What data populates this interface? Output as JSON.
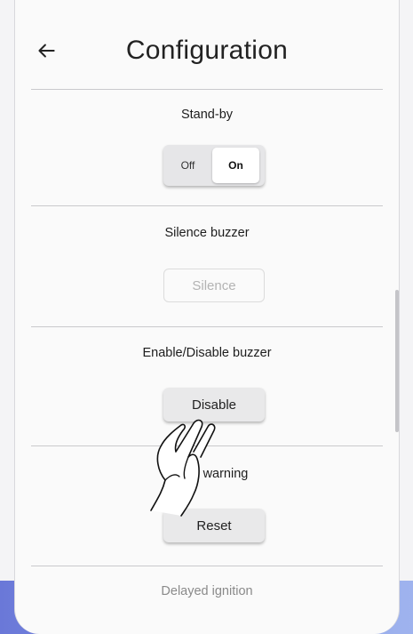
{
  "header": {
    "title": "Configuration",
    "back_icon": "arrow-left-icon"
  },
  "sections": {
    "standby": {
      "title": "Stand-by",
      "off_label": "Off",
      "on_label": "On",
      "selected": "On"
    },
    "silence_buzzer": {
      "title": "Silence buzzer",
      "button_label": "Silence",
      "enabled": false
    },
    "enable_buzzer": {
      "title": "Enable/Disable buzzer",
      "button_label": "Disable"
    },
    "reset_warning": {
      "title": "Reset warning",
      "button_label": "Reset"
    },
    "delayed_ignition": {
      "title": "Delayed ignition"
    }
  },
  "overlay": {
    "icon": "tap-hand-icon"
  },
  "colors": {
    "accent": "#7b8fe2",
    "background": "#fafafa",
    "divider": "#c9c9cc"
  }
}
